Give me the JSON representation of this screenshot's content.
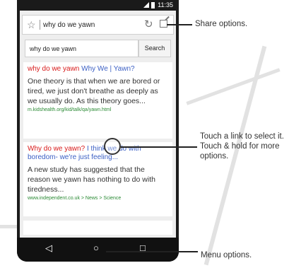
{
  "status_bar": {
    "time": "11:35"
  },
  "browser": {
    "url": "why do we yawn",
    "search_query": "why do we yawn",
    "search_button": "Search"
  },
  "results": [
    {
      "title_red": "why do we yawn",
      "title_blue": "Why We | Yawn?",
      "snippet": "One theory is that when we are bored or tired, we just don't breathe as deeply as we usually do. As this theory goes...",
      "source": "m.kidshealth.org/kid/talk/qa/yawn.html"
    },
    {
      "title_red": "Why do we yawn?",
      "title_blue": "I think we do with boredom- we're just feeling...",
      "snippet": "A new study has suggested that the reason we yawn has nothing to do with tiredness...",
      "source": "www.independent.co.uk > News > Science"
    }
  ],
  "bottom_nav": {
    "back_icon": "<",
    "forward_icon": ">",
    "menu_icon": "☰",
    "home_icon": "⌂",
    "tabs_icon": "⧉"
  },
  "system_nav": {
    "back": "◁",
    "home": "○",
    "recents": "□"
  },
  "callouts": {
    "share": "Share options.",
    "link": "Touch a link to select it. Touch & hold for more options.",
    "menu": "Menu options."
  }
}
